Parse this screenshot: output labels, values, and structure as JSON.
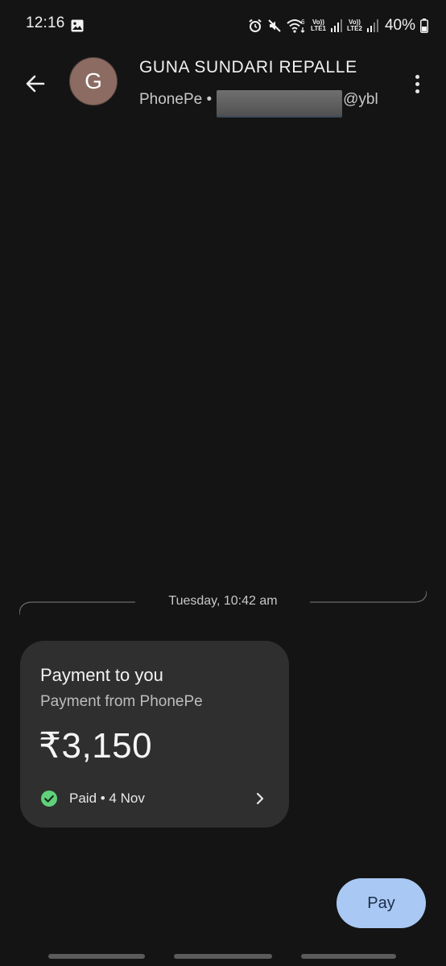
{
  "status_bar": {
    "time": "12:16",
    "network_1": {
      "top": "Vo))",
      "bottom": "LTE1"
    },
    "network_2": {
      "top": "Vo))",
      "bottom": "LTE2"
    },
    "wifi_label": "6",
    "battery": "40%"
  },
  "header": {
    "avatar_letter": "G",
    "avatar_color": "#8b6b62",
    "contact_name": "GUNA SUNDARI REPALLE",
    "app_name": "PhonePe •",
    "upi_suffix": "@ybl"
  },
  "conversation": {
    "date_label": "Tuesday, 10:42 am"
  },
  "payment_card": {
    "title": "Payment to you",
    "subtitle": "Payment from PhonePe",
    "amount": "₹3,150",
    "status": "Paid • 4 Nov",
    "status_color": "#5fd17a"
  },
  "actions": {
    "pay_label": "Pay",
    "pay_color": "#a9c9f4"
  }
}
